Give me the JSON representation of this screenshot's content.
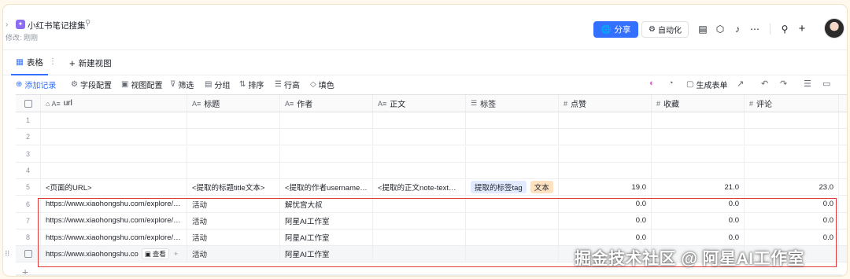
{
  "title_bar": {
    "back_glyph": "›",
    "app_glyph": "✦",
    "doc_title": "小红书笔记搜集",
    "pin_glyph": "⚲",
    "subtitle": "修改: 刚刚",
    "share_label": "分享",
    "share_icon": "🌐",
    "automation_label": "自动化",
    "automation_icon": "⚙",
    "icons": [
      "form-icon",
      "puzzle-icon",
      "bell-icon",
      "more-icon",
      "search-icon",
      "plus-icon"
    ],
    "icon_glyphs": [
      "▤",
      "⬡",
      "♪",
      "⋯",
      "⚲",
      "+"
    ]
  },
  "view_tabs": {
    "active_tab": "表格",
    "active_icon": "▦",
    "more_glyph": "⋮",
    "new_view_label": "新建视图",
    "new_view_icon": "+"
  },
  "toolbar": {
    "add_record": "添加记录",
    "add_icon": "⊕",
    "field_config": "字段配置",
    "field_icon": "⚙",
    "view_config": "视图配置",
    "view_icon": "▣",
    "filter": "筛选",
    "filter_icon": "⊽",
    "group": "分组",
    "group_icon": "▤",
    "sort": "排序",
    "sort_icon": "⇅",
    "row_height": "行高",
    "row_icon": "☰",
    "fill_color": "填色",
    "fill_icon": "◇",
    "generate_form": "生成表单",
    "generate_icon": "▢",
    "right_icons": [
      "palette-icon",
      "history-icon",
      "share-arrow-icon",
      "undo-icon",
      "redo-icon",
      "list-settings-icon",
      "comment-icon"
    ],
    "right_glyphs": [
      "◐",
      "◔",
      "↗",
      "↶",
      "↷",
      "☰",
      "▭"
    ]
  },
  "table": {
    "columns": [
      {
        "name": "url",
        "icon": "⌂ A≡"
      },
      {
        "name": "标题",
        "icon": "A≡"
      },
      {
        "name": "作者",
        "icon": "A≡"
      },
      {
        "name": "正文",
        "icon": "A≡"
      },
      {
        "name": "标签",
        "icon": "☰"
      },
      {
        "name": "点赞",
        "icon": "#"
      },
      {
        "name": "收藏",
        "icon": "#"
      },
      {
        "name": "评论",
        "icon": "#"
      }
    ],
    "rows": [
      {
        "n": "1",
        "url": "",
        "title": "",
        "author": "",
        "body": "",
        "tags": [],
        "likes": "",
        "favs": "",
        "comments": ""
      },
      {
        "n": "2",
        "url": "",
        "title": "",
        "author": "",
        "body": "",
        "tags": [],
        "likes": "",
        "favs": "",
        "comments": ""
      },
      {
        "n": "3",
        "url": "",
        "title": "",
        "author": "",
        "body": "",
        "tags": [],
        "likes": "",
        "favs": "",
        "comments": ""
      },
      {
        "n": "4",
        "url": "",
        "title": "",
        "author": "",
        "body": "",
        "tags": [],
        "likes": "",
        "favs": "",
        "comments": ""
      },
      {
        "n": "5",
        "url": "<页面的URL>",
        "title": "<提取的标题title文本>",
        "author": "<提取的作者username…",
        "body": "<提取的正文note-text…",
        "tags": [
          "提取的标签tag",
          "文本"
        ],
        "likes": "19.0",
        "favs": "21.0",
        "comments": "23.0"
      },
      {
        "n": "6",
        "url": "https://www.xiaohongshu.com/explore/…",
        "title": "活动",
        "author": "解忧宫大叔",
        "body": "",
        "tags": [],
        "likes": "0.0",
        "favs": "0.0",
        "comments": "0.0"
      },
      {
        "n": "7",
        "url": "https://www.xiaohongshu.com/explore/…",
        "title": "活动",
        "author": "阿星AI工作室",
        "body": "",
        "tags": [],
        "likes": "0.0",
        "favs": "0.0",
        "comments": "0.0"
      },
      {
        "n": "8",
        "url": "https://www.xiaohongshu.com/explore/…",
        "title": "活动",
        "author": "阿星AI工作室",
        "body": "",
        "tags": [],
        "likes": "0.0",
        "favs": "0.0",
        "comments": "0.0"
      },
      {
        "n": "",
        "url": "https://www.xiaohongshu.co",
        "title": "活动",
        "author": "阿星AI工作室",
        "body": "",
        "tags": [],
        "likes": "",
        "favs": "",
        "comments": ""
      }
    ],
    "view_chip": "查看",
    "view_chip_icon": "▣",
    "add_row_glyph": "+",
    "drag_glyph": "⠿",
    "row_add_glyph": "+"
  },
  "watermark": "掘金技术社区 @ 阿星AI工作室",
  "colors": {
    "accent": "#3370ff",
    "highlight": "#e03a3a",
    "tag_blue": "#e1eaff",
    "tag_orange": "#fde2c2"
  }
}
